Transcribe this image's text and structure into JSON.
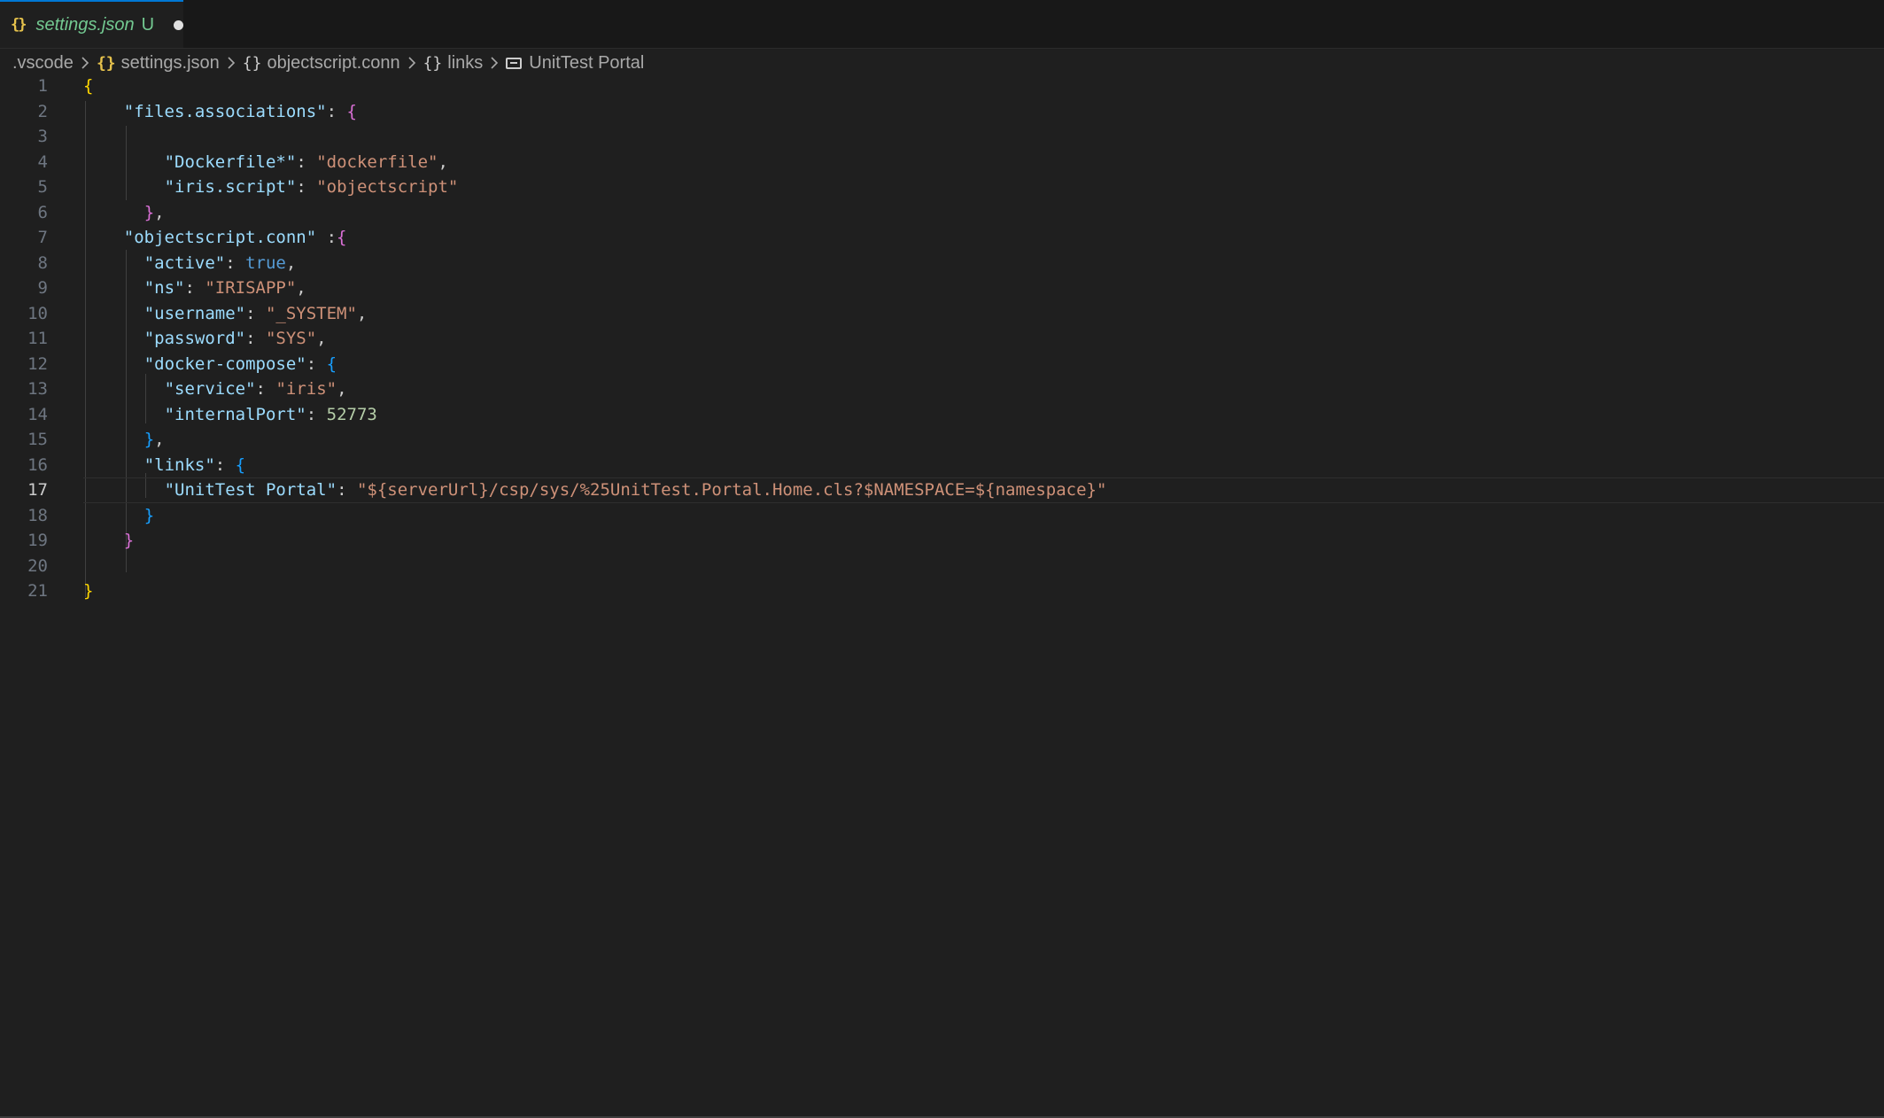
{
  "tab": {
    "filename": "settings.json",
    "status": "U"
  },
  "breadcrumb": [
    {
      "label": ".vscode",
      "icon": "none"
    },
    {
      "label": "settings.json",
      "icon": "json-icon"
    },
    {
      "label": "objectscript.conn",
      "icon": "object-icon"
    },
    {
      "label": "links",
      "icon": "object-icon"
    },
    {
      "label": "UnitTest Portal",
      "icon": "string-icon"
    }
  ],
  "editor": {
    "current_line": 17,
    "lines": [
      {
        "n": "1",
        "indent": 0,
        "tokens": [
          [
            "br1",
            "{"
          ]
        ]
      },
      {
        "n": "2",
        "indent": 4,
        "tokens": [
          [
            "k",
            "\"files.associations\""
          ],
          [
            "p",
            ": "
          ],
          [
            "br2",
            "{"
          ]
        ]
      },
      {
        "n": "3",
        "indent": 0,
        "tokens": []
      },
      {
        "n": "4",
        "indent": 8,
        "tokens": [
          [
            "k",
            "\"Dockerfile*\""
          ],
          [
            "p",
            ": "
          ],
          [
            "s",
            "\"dockerfile\""
          ],
          [
            "p",
            ","
          ]
        ]
      },
      {
        "n": "5",
        "indent": 8,
        "tokens": [
          [
            "k",
            "\"iris.script\""
          ],
          [
            "p",
            ": "
          ],
          [
            "s",
            "\"objectscript\""
          ]
        ]
      },
      {
        "n": "6",
        "indent": 6,
        "tokens": [
          [
            "br2",
            "}"
          ],
          [
            "p",
            ","
          ]
        ]
      },
      {
        "n": "7",
        "indent": 4,
        "tokens": [
          [
            "k",
            "\"objectscript.conn\""
          ],
          [
            "p",
            " :"
          ],
          [
            "br2",
            "{"
          ]
        ]
      },
      {
        "n": "8",
        "indent": 6,
        "tokens": [
          [
            "k",
            "\"active\""
          ],
          [
            "p",
            ": "
          ],
          [
            "b",
            "true"
          ],
          [
            "p",
            ","
          ]
        ]
      },
      {
        "n": "9",
        "indent": 6,
        "tokens": [
          [
            "k",
            "\"ns\""
          ],
          [
            "p",
            ": "
          ],
          [
            "s",
            "\"IRISAPP\""
          ],
          [
            "p",
            ","
          ]
        ]
      },
      {
        "n": "10",
        "indent": 6,
        "tokens": [
          [
            "k",
            "\"username\""
          ],
          [
            "p",
            ": "
          ],
          [
            "s",
            "\"_SYSTEM\""
          ],
          [
            "p",
            ","
          ]
        ]
      },
      {
        "n": "11",
        "indent": 6,
        "tokens": [
          [
            "k",
            "\"password\""
          ],
          [
            "p",
            ": "
          ],
          [
            "s",
            "\"SYS\""
          ],
          [
            "p",
            ","
          ]
        ]
      },
      {
        "n": "12",
        "indent": 6,
        "tokens": [
          [
            "k",
            "\"docker-compose\""
          ],
          [
            "p",
            ": "
          ],
          [
            "br3",
            "{"
          ]
        ]
      },
      {
        "n": "13",
        "indent": 8,
        "tokens": [
          [
            "k",
            "\"service\""
          ],
          [
            "p",
            ": "
          ],
          [
            "s",
            "\"iris\""
          ],
          [
            "p",
            ","
          ]
        ]
      },
      {
        "n": "14",
        "indent": 8,
        "tokens": [
          [
            "k",
            "\"internalPort\""
          ],
          [
            "p",
            ": "
          ],
          [
            "n",
            "52773"
          ]
        ]
      },
      {
        "n": "15",
        "indent": 6,
        "tokens": [
          [
            "br3",
            "}"
          ],
          [
            "p",
            ","
          ]
        ]
      },
      {
        "n": "16",
        "indent": 6,
        "tokens": [
          [
            "k",
            "\"links\""
          ],
          [
            "p",
            ": "
          ],
          [
            "br3",
            "{"
          ]
        ]
      },
      {
        "n": "17",
        "indent": 8,
        "tokens": [
          [
            "k",
            "\"UnitTest Portal\""
          ],
          [
            "p",
            ": "
          ],
          [
            "s",
            "\"${serverUrl}/csp/sys/%25UnitTest.Portal.Home.cls?$NAMESPACE=${namespace}\""
          ]
        ]
      },
      {
        "n": "18",
        "indent": 6,
        "tokens": [
          [
            "br3",
            "}"
          ]
        ]
      },
      {
        "n": "19",
        "indent": 4,
        "tokens": [
          [
            "br2",
            "}"
          ]
        ]
      },
      {
        "n": "20",
        "indent": 0,
        "tokens": []
      },
      {
        "n": "21",
        "indent": 0,
        "tokens": [
          [
            "br1",
            "}"
          ]
        ]
      }
    ]
  }
}
